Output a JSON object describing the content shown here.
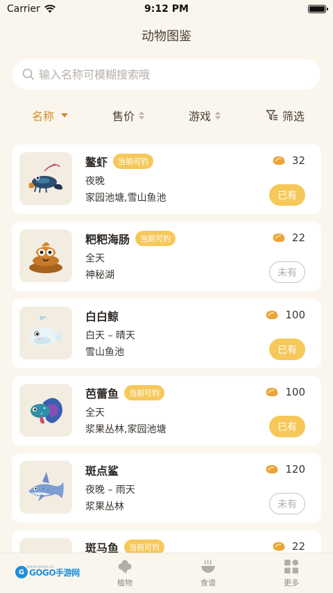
{
  "status": {
    "carrier": "Carrier",
    "time": "9:12 PM"
  },
  "title": "动物图鉴",
  "search": {
    "placeholder": "输入名称可模糊搜索哦"
  },
  "sort": {
    "name": "名称",
    "price": "售价",
    "game": "游戏",
    "filter": "筛选"
  },
  "animals": [
    {
      "name": "鳌虾",
      "tag": "当前可钓",
      "time": "夜晚",
      "location": "家园池塘,雪山鱼池",
      "price": "32",
      "status": "已有",
      "owned": true
    },
    {
      "name": "粑粑海肠",
      "tag": "当前可钓",
      "time": "全天",
      "location": "神秘湖",
      "price": "22",
      "status": "未有",
      "owned": false
    },
    {
      "name": "白白鲸",
      "tag": "",
      "time": "白天 – 晴天",
      "location": "雪山鱼池",
      "price": "100",
      "status": "已有",
      "owned": true
    },
    {
      "name": "芭蕾鱼",
      "tag": "当前可钓",
      "time": "全天",
      "location": "浆果丛林,家园池塘",
      "price": "100",
      "status": "已有",
      "owned": true
    },
    {
      "name": "斑点鲨",
      "tag": "",
      "time": "夜晚 – 雨天",
      "location": "浆果丛林",
      "price": "120",
      "status": "未有",
      "owned": false
    },
    {
      "name": "斑马鱼",
      "tag": "当前可钓",
      "time": "",
      "location": "",
      "price": "22",
      "status": "",
      "owned": false
    }
  ],
  "tabs": {
    "plant": "植物",
    "recipe": "食谱",
    "more": "更多"
  },
  "logo": {
    "text": "GOGO手游网",
    "sub": "www.gogo.cn"
  },
  "colors": {
    "accent": "#d28a2a",
    "tag": "#f6c85a",
    "background": "#faf6ee"
  }
}
